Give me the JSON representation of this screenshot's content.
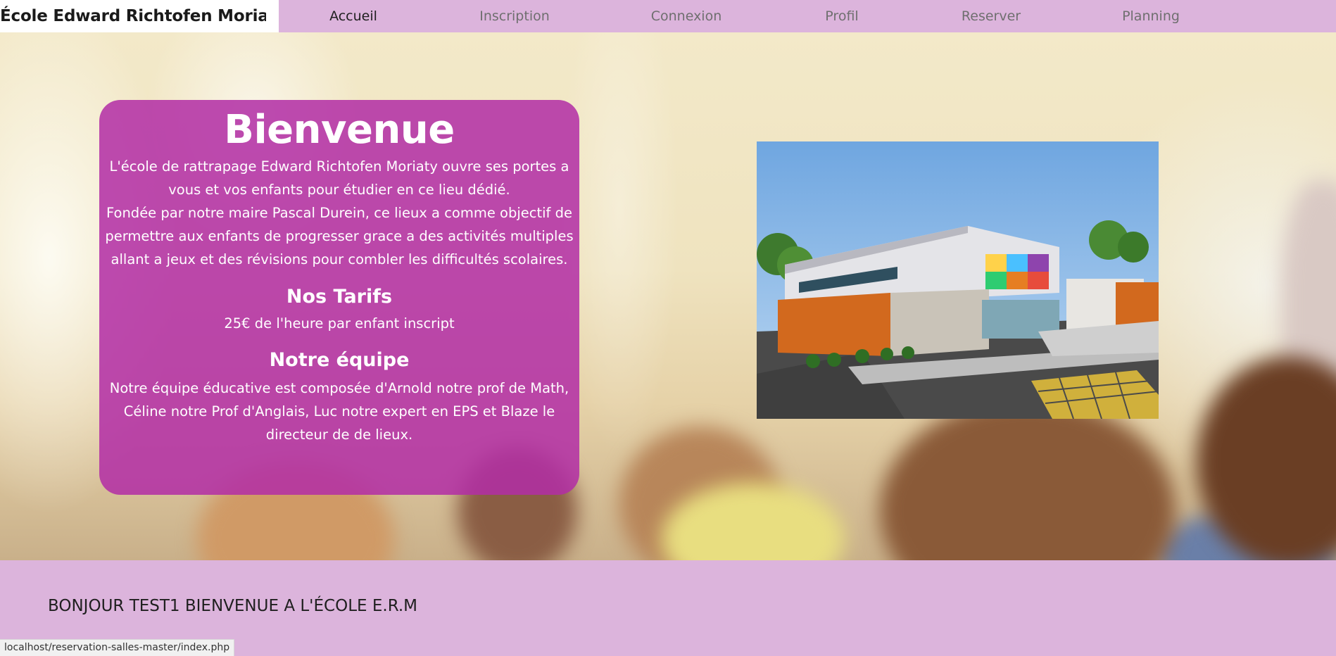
{
  "header": {
    "brand": "École Edward Richtofen Moriaty",
    "nav": [
      {
        "label": "Accueil",
        "active": true
      },
      {
        "label": "Inscription",
        "active": false
      },
      {
        "label": "Connexion",
        "active": false
      },
      {
        "label": "Profil",
        "active": false
      },
      {
        "label": "Reserver",
        "active": false
      },
      {
        "label": "Planning",
        "active": false
      }
    ]
  },
  "welcome": {
    "title": "Bienvenue",
    "intro_line1": "L'école de rattrapage Edward Richtofen Moriaty ouvre ses portes a vous et vos enfants pour étudier en ce lieu dédié.",
    "intro_line2": "Fondée par notre maire Pascal Durein, ce lieux a comme objectif de permettre aux enfants de progresser grace a des activités multiples allant a jeux et des révisions pour combler les difficultés scolaires.",
    "tarifs_title": "Nos Tarifs",
    "tarifs_text": "25€ de l'heure par enfant inscript",
    "team_title": "Notre équipe",
    "team_text": "Notre équipe éducative est composée d'Arnold notre prof de Math, Céline notre Prof d'Anglais, Luc notre expert en EPS et Blaze le directeur de de lieux."
  },
  "footer": {
    "greeting": "BONJOUR TEST1 BIENVENUE A L'ÉCOLE E.R.M"
  },
  "status_bar": {
    "url": "localhost/reservation-salles-master/index.php"
  },
  "colors": {
    "nav_bg": "#dcb4dc",
    "card_bg": "#b22da5",
    "footer_bg": "#dcb4dc"
  }
}
